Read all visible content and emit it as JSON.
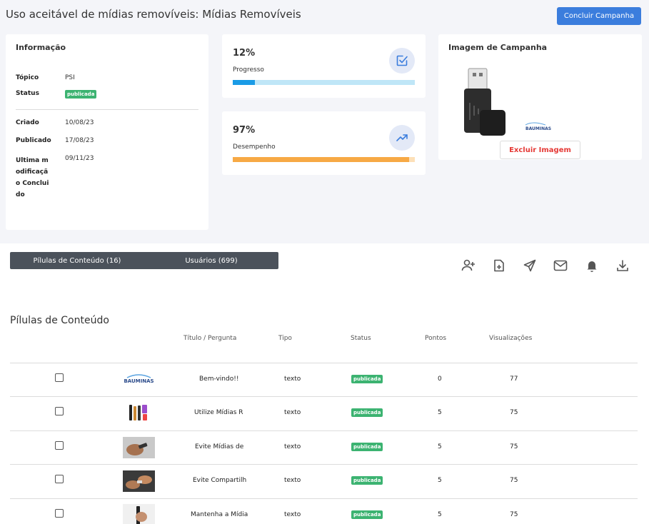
{
  "header": {
    "title": "Uso aceitável de mídias removíveis: Mídias Removíveis",
    "conclude_button": "Concluir Campanha"
  },
  "info_card": {
    "title": "Informação",
    "topic_label": "Tópico",
    "topic_value": "PSI",
    "status_label": "Status",
    "status_value": "publicada",
    "created_label": "Criado",
    "created_value": "10/08/23",
    "published_label": "Publicado",
    "published_value": "17/08/23",
    "last_mod_label": "Ultima modificação Concluido",
    "last_mod_value": "09/11/23"
  },
  "progress_card": {
    "value": "12%",
    "label": "Progresso",
    "fraction": 0.12,
    "icon": "checkbox-icon"
  },
  "performance_card": {
    "value": "97%",
    "label": "Desempenho",
    "fraction": 0.97,
    "icon": "trending-up-icon"
  },
  "image_card": {
    "title": "Imagem de Campanha",
    "delete_button": "Excluir Imagem",
    "logo_text": "BAUMINAS"
  },
  "tabs": [
    {
      "label": "Pílulas de Conteúdo (16)"
    },
    {
      "label": "Usuários (699)"
    }
  ],
  "toolbar": [
    "add-user-icon",
    "add-file-icon",
    "send-icon",
    "mail-icon",
    "bell-icon",
    "download-icon"
  ],
  "section": {
    "title": "Pílulas de Conteúdo",
    "columns": [
      "Título / Pergunta",
      "Tipo",
      "Status",
      "Pontos",
      "Visualizações"
    ]
  },
  "rows": [
    {
      "title": "Bem-vindo!!",
      "type": "texto",
      "status": "publicada",
      "points": "0",
      "views": "77",
      "thumb_text": "BAUMINAS"
    },
    {
      "title": "Utilize Mídias R",
      "type": "texto",
      "status": "publicada",
      "points": "5",
      "views": "75",
      "thumb_text": ""
    },
    {
      "title": "Evite Mídias de",
      "type": "texto",
      "status": "publicada",
      "points": "5",
      "views": "75",
      "thumb_text": ""
    },
    {
      "title": "Evite Compartilh",
      "type": "texto",
      "status": "publicada",
      "points": "5",
      "views": "75",
      "thumb_text": ""
    },
    {
      "title": "Mantenha a Mídia",
      "type": "texto",
      "status": "publicada",
      "points": "5",
      "views": "75",
      "thumb_text": ""
    }
  ],
  "colors": {
    "primary": "#3b7ddd",
    "progress_fill": "#1a9be6",
    "progress_track": "#bfe6f7",
    "performance_fill": "#f7a945",
    "performance_track": "#fde0b8",
    "badge": "#3cb371",
    "danger": "#e53935",
    "tabbar": "#4b525b"
  }
}
